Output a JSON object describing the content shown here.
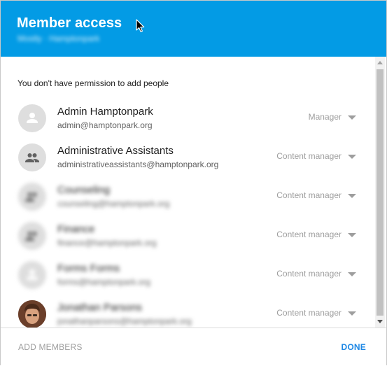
{
  "dialog": {
    "title": "Member access",
    "subtitle": "Mostly · Hamptonpark",
    "notice": "You don't have permission to add people"
  },
  "members": [
    {
      "name": "Admin Hamptonpark",
      "email": "admin@hamptonpark.org",
      "role": "Manager",
      "avatar": "person-icon",
      "blurred": false
    },
    {
      "name": "Administrative Assistants",
      "email": "administrativeassistants@hamptonpark.org",
      "role": "Content manager",
      "avatar": "group-icon",
      "blurred": false
    },
    {
      "name": "Counseling",
      "email": "counseling@hamptonpark.org",
      "role": "Content manager",
      "avatar": "group-icon",
      "blurred": true
    },
    {
      "name": "Finance",
      "email": "finance@hamptonpark.org",
      "role": "Content manager",
      "avatar": "group-icon",
      "blurred": true
    },
    {
      "name": "Forms Forms",
      "email": "forms@hamptonpark.org",
      "role": "Content manager",
      "avatar": "person-icon",
      "blurred": true
    },
    {
      "name": "Jonathan Parsons",
      "email": "jonathanparsons@hamptonpark.org",
      "role": "Content manager",
      "avatar": "photo",
      "blurred": true
    }
  ],
  "footer": {
    "add_members": "ADD MEMBERS",
    "done": "DONE"
  },
  "colors": {
    "header": "#039be5",
    "done": "#1e88e5"
  }
}
